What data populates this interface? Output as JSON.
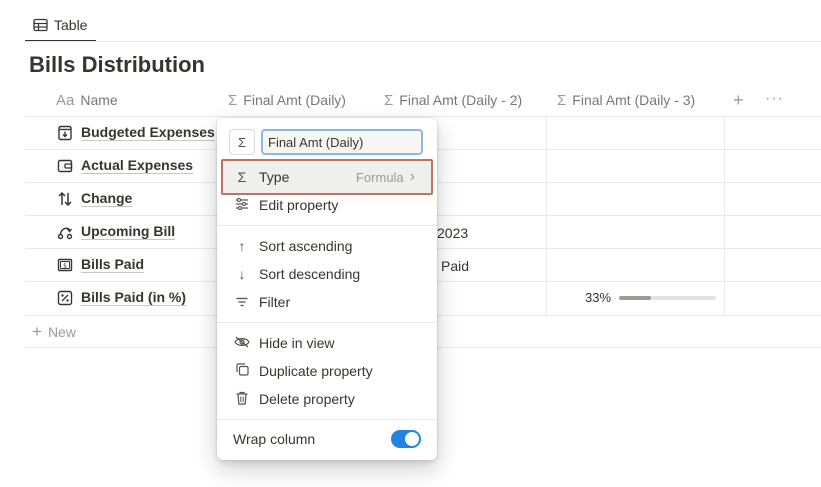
{
  "view_tab": {
    "label": "Table",
    "icon": "table-icon"
  },
  "database": {
    "title": "Bills Distribution"
  },
  "columns": [
    {
      "icon_text": "Aa",
      "label": "Name"
    },
    {
      "icon_text": "Σ",
      "label": "Final Amt (Daily)"
    },
    {
      "icon_text": "Σ",
      "label": "Final Amt (Daily - 2)"
    },
    {
      "icon_text": "Σ",
      "label": "Final Amt (Daily - 3)"
    }
  ],
  "header_actions": {
    "add": "+",
    "more": "···"
  },
  "rows": [
    {
      "name": "Budgeted Expenses",
      "icon": "piggy-bank-icon"
    },
    {
      "name": "Actual Expenses",
      "icon": "wallet-icon"
    },
    {
      "name": "Change",
      "icon": "swap-arrows-icon"
    },
    {
      "name": "Upcoming Bill",
      "icon": "route-icon",
      "col2_text": "2023"
    },
    {
      "name": "Bills Paid",
      "icon": "bill-icon",
      "col2_text": "Paid"
    },
    {
      "name": "Bills Paid (in %)",
      "icon": "percent-icon",
      "col4_progress_label": "33%",
      "col4_progress_value": 0.33
    }
  ],
  "new_row": {
    "label": "New"
  },
  "menu": {
    "sigma_button": "Σ",
    "name_value": "Final Amt (Daily)",
    "type_item": {
      "icon": "Σ",
      "label": "Type",
      "value": "Formula",
      "chevron": "›"
    },
    "items": [
      {
        "icon": "≡",
        "label": "Edit property"
      },
      {
        "icon": "↑",
        "label": "Sort ascending"
      },
      {
        "icon": "↓",
        "label": "Sort descending"
      },
      {
        "icon": "≡",
        "label": "Filter"
      },
      {
        "icon": "◎",
        "label": "Hide in view"
      },
      {
        "icon": "⧉",
        "label": "Duplicate property"
      },
      {
        "icon": "🗑",
        "label": "Delete property"
      }
    ],
    "wrap_column": {
      "label": "Wrap column",
      "enabled": true
    }
  },
  "colors": {
    "accent": "#2383e2",
    "highlight_border": "#c0725e"
  }
}
